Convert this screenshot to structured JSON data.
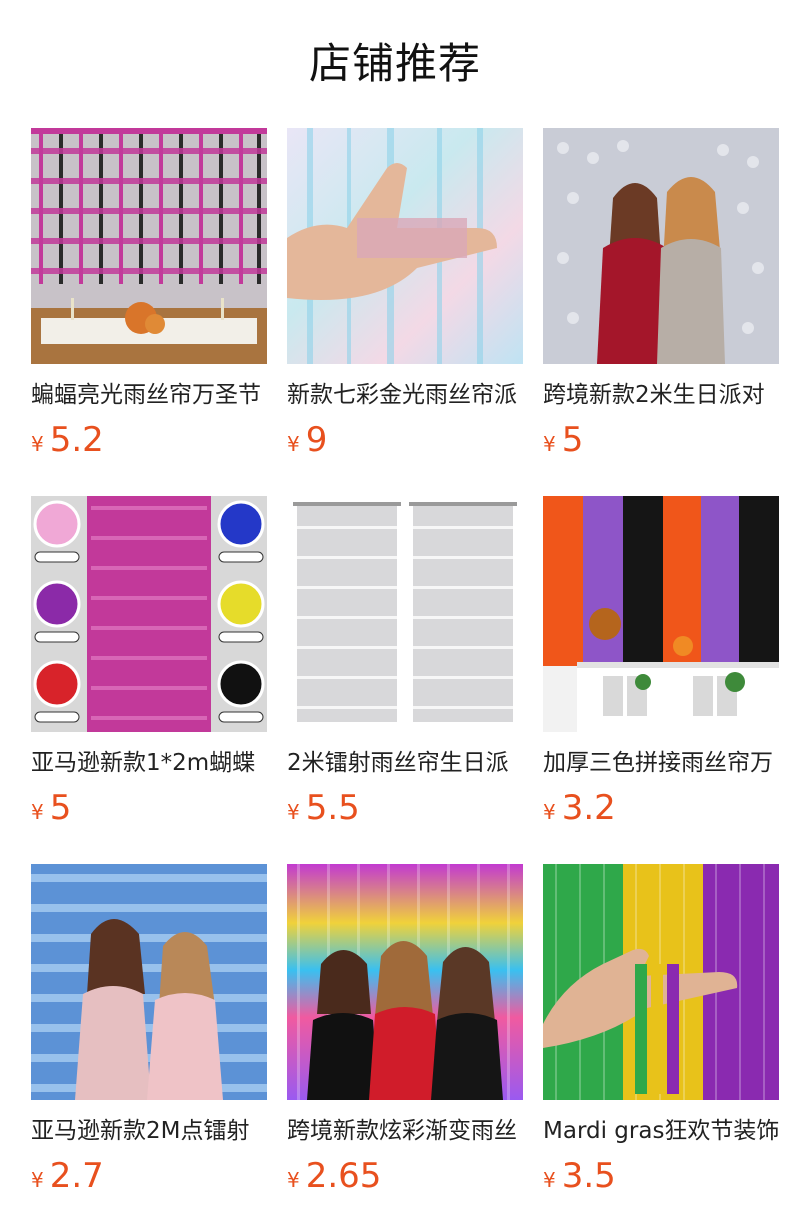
{
  "section": {
    "title": "店铺推荐"
  },
  "products": [
    {
      "title": "蝙蝠亮光雨丝帘万圣节",
      "currency": "¥",
      "price": "5.2",
      "image_icon": "bat-curtain-table-photo"
    },
    {
      "title": "新款七彩金光雨丝帘派",
      "currency": "¥",
      "price": "9",
      "image_icon": "iridescent-tinsel-hand-photo"
    },
    {
      "title": "跨境新款2米生日派对",
      "currency": "¥",
      "price": "5",
      "image_icon": "sequin-curtain-party-women-photo"
    },
    {
      "title": "亚马逊新款1*2m蝴蝶",
      "currency": "¥",
      "price": "5",
      "image_icon": "butterfly-curtain-colors-photo"
    },
    {
      "title": "2米镭射雨丝帘生日派",
      "currency": "¥",
      "price": "5.5",
      "image_icon": "silver-laser-curtain-photo"
    },
    {
      "title": "加厚三色拼接雨丝帘万",
      "currency": "¥",
      "price": "3.2",
      "image_icon": "tricolor-fringe-curtain-photo"
    },
    {
      "title": "亚马逊新款2M点镭射",
      "currency": "¥",
      "price": "2.7",
      "image_icon": "blue-dot-curtain-women-photo"
    },
    {
      "title": "跨境新款炫彩渐变雨丝",
      "currency": "¥",
      "price": "2.65",
      "image_icon": "rainbow-gradient-curtain-women-photo"
    },
    {
      "title": "Mardi gras狂欢节装饰",
      "currency": "¥",
      "price": "3.5",
      "image_icon": "mardi-gras-fringe-hand-photo"
    }
  ],
  "colors": {
    "price": "#e8501e",
    "title": "#222222",
    "heading": "#111111"
  }
}
